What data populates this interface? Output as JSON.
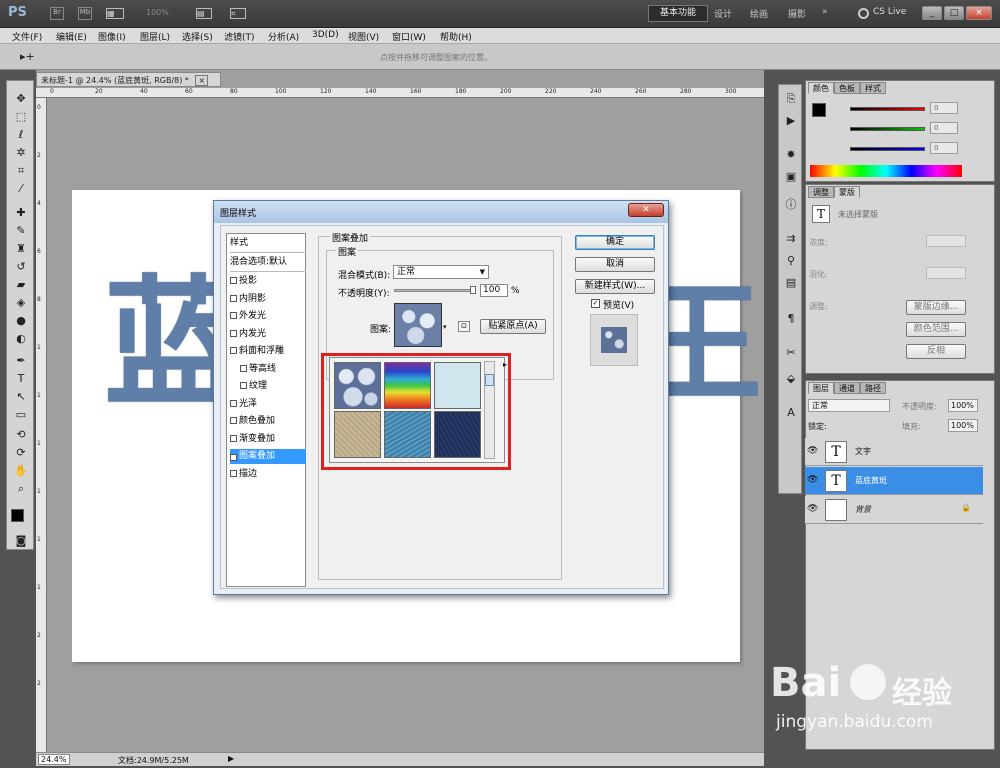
{
  "app": {
    "logo": "PS",
    "zoom_display": "100%",
    "workspaces": [
      "基本功能",
      "设计",
      "绘画",
      "摄影",
      "»"
    ],
    "cs_live": "CS Live",
    "window_buttons": [
      "_",
      "□",
      "×"
    ]
  },
  "menu": [
    "文件(F)",
    "编辑(E)",
    "图像(I)",
    "图层(L)",
    "选择(S)",
    "滤镜(T)",
    "分析(A)",
    "3D(D)",
    "视图(V)",
    "窗口(W)",
    "帮助(H)"
  ],
  "options_bar": {
    "hint": "点按并拖移可调整图案的位置。"
  },
  "document": {
    "tab_title": "未标题-1 @ 24.4% (蓝底黄斑, RGB/8) *",
    "canvas_text": "蓝",
    "canvas_text_right": "王",
    "zoom": "24.4%",
    "doc_size": "文档:24.9M/5.25M"
  },
  "ruler_top": [
    "0",
    "20",
    "40",
    "60",
    "80",
    "100",
    "120",
    "140",
    "160",
    "180",
    "200",
    "220",
    "240",
    "260",
    "280",
    "300"
  ],
  "ruler_left": [
    "0",
    "2",
    "4",
    "6",
    "8",
    "1",
    "1",
    "1",
    "1",
    "1",
    "1",
    "2",
    "2"
  ],
  "color_panel": {
    "tabs": [
      "颜色",
      "色板",
      "样式"
    ],
    "values": [
      "0",
      "0",
      "0"
    ]
  },
  "adjust_panel": {
    "tabs": [
      "调整",
      "蒙版"
    ],
    "mask_label": "未选择蒙版",
    "density": "浓度:",
    "feather": "羽化:",
    "refine": "调整:",
    "buttons": [
      "蒙版边缘...",
      "颜色范围...",
      "反相"
    ]
  },
  "layers_panel": {
    "tabs": [
      "图层",
      "通道",
      "路径"
    ],
    "blend": "正常",
    "opacity_label": "不透明度:",
    "opacity": "100%",
    "lock_label": "锁定:",
    "fill_label": "填充:",
    "fill": "100%",
    "layers": [
      {
        "name": "文字",
        "type": "T",
        "selected": false
      },
      {
        "name": "蓝底黄斑",
        "type": "T",
        "selected": true
      },
      {
        "name": "背景",
        "type": "",
        "selected": false
      }
    ]
  },
  "dialog": {
    "title": "图层样式",
    "style_list": [
      {
        "label": "样式",
        "checkbox": false,
        "active": false,
        "header": true
      },
      {
        "label": "混合选项:默认",
        "checkbox": false,
        "active": false,
        "header": true
      },
      {
        "label": "投影",
        "checkbox": true,
        "checked": false
      },
      {
        "label": "内阴影",
        "checkbox": true,
        "checked": false
      },
      {
        "label": "外发光",
        "checkbox": true,
        "checked": false
      },
      {
        "label": "内发光",
        "checkbox": true,
        "checked": false
      },
      {
        "label": "斜面和浮雕",
        "checkbox": true,
        "checked": false
      },
      {
        "label": "等高线",
        "checkbox": true,
        "checked": false,
        "indent": true
      },
      {
        "label": "纹理",
        "checkbox": true,
        "checked": false,
        "indent": true
      },
      {
        "label": "光泽",
        "checkbox": true,
        "checked": false
      },
      {
        "label": "颜色叠加",
        "checkbox": true,
        "checked": false
      },
      {
        "label": "渐变叠加",
        "checkbox": true,
        "checked": false
      },
      {
        "label": "图案叠加",
        "checkbox": true,
        "checked": true,
        "active": true
      },
      {
        "label": "描边",
        "checkbox": true,
        "checked": false
      }
    ],
    "section_title": "图案叠加",
    "group_title": "图案",
    "blend_mode_label": "混合模式(B):",
    "blend_mode_value": "正常",
    "opacity_label": "不透明度(Y):",
    "opacity_value": "100",
    "opacity_unit": "%",
    "pattern_label": "图案:",
    "snap_button": "贴紧原点(A)",
    "ok": "确定",
    "cancel": "取消",
    "new_style": "新建样式(W)...",
    "preview_label": "预览(V)",
    "preview_checked": true,
    "pattern_swatches": [
      "bubbles",
      "rainbow",
      "light-blue",
      "tan-paper",
      "blue-texture",
      "dark-navy"
    ]
  },
  "watermark": {
    "brand": "Bai",
    "brand2": "经验",
    "url": "jingyan.baidu.com"
  }
}
